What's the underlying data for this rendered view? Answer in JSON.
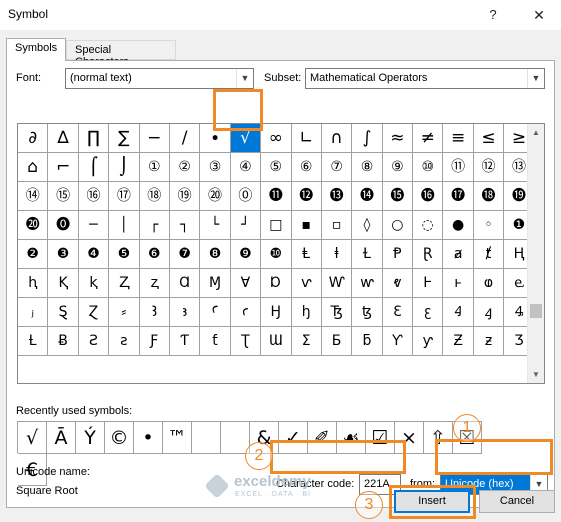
{
  "window": {
    "title": "Symbol",
    "help_glyph": "?",
    "close_glyph": "✕"
  },
  "tabs": [
    {
      "label": "Symbols",
      "active": true
    },
    {
      "label": "Special Characters",
      "active": false
    }
  ],
  "font": {
    "label": "Font:",
    "value": "(normal text)"
  },
  "subset": {
    "label": "Subset:",
    "value": "Mathematical Operators"
  },
  "symbol_grid": {
    "selected_index": 7,
    "rows": [
      [
        "∂",
        "∆",
        "∏",
        "∑",
        "−",
        "∕",
        "∙",
        "√",
        "∞",
        "∟",
        "∩",
        "∫",
        "≈",
        "≠",
        "≡",
        "≤",
        "≥"
      ],
      [
        "⌂",
        "⌐",
        "⌠",
        "⌡",
        "①",
        "②",
        "③",
        "④",
        "⑤",
        "⑥",
        "⑦",
        "⑧",
        "⑨",
        "⑩",
        "⑪",
        "⑫",
        "⑬"
      ],
      [
        "⑭",
        "⑮",
        "⑯",
        "⑰",
        "⑱",
        "⑲",
        "⑳",
        "⓪",
        "⓫",
        "⓬",
        "⓭",
        "⓮",
        "⓯",
        "⓰",
        "⓱",
        "⓲",
        "⓳"
      ],
      [
        "⓴",
        "⓿",
        "─",
        "│",
        "┌",
        "┐",
        "└",
        "┘",
        "□",
        "▪",
        "▫",
        "◊",
        "○",
        "◌",
        "●",
        "◦",
        "❶"
      ],
      [
        "❷",
        "❸",
        "❹",
        "❺",
        "❻",
        "❼",
        "❽",
        "❾",
        "❿",
        "Ⱡ",
        "ⱡ",
        "Ɫ",
        "Ᵽ",
        "Ɽ",
        "ⱥ",
        "ⱦ",
        "Ⱨ"
      ],
      [
        "ⱨ",
        "Ⱪ",
        "ⱪ",
        "Ⱬ",
        "ⱬ",
        "Ɑ",
        "Ɱ",
        "Ɐ",
        "Ɒ",
        "ⱱ",
        "Ⱳ",
        "ⱳ",
        "ⱴ",
        "Ⱶ",
        "ⱶ",
        "ⱷ",
        "ⱸ"
      ],
      [
        "ⱼ",
        "Ȿ",
        "Ɀ",
        "⸗",
        "Ꜣ",
        "ꜣ",
        "Ꜥ",
        "ꜥ",
        "Ꜧ",
        "ꜧ",
        "Ꜩ",
        "ꜩ",
        "Ꜫ",
        "ꜫ",
        "Ꜭ",
        "ꜭ",
        "Ꜯ"
      ],
      [
        "Ƚ",
        "Ƀ",
        "Ƨ",
        "ƨ",
        "Ƒ",
        "Ƭ",
        "ƭ",
        "Ʈ",
        "Ɯ",
        "Ʃ",
        "Ƃ",
        "ƃ",
        "Ƴ",
        "ƴ",
        "Ƶ",
        "ƶ",
        "Ʒ"
      ]
    ]
  },
  "recent": {
    "label": "Recently used symbols:",
    "symbols": [
      "√",
      "Ā",
      "Ý",
      "©",
      "•",
      "™",
      "",
      "",
      "&",
      "✓",
      "✐",
      "☙",
      "☑",
      "×",
      "⇧",
      "☒",
      "€"
    ]
  },
  "unicode_name": {
    "label": "Unicode name:",
    "value": "Square Root"
  },
  "char_code": {
    "label": "Character code:",
    "value": "221A"
  },
  "from": {
    "label": "from:",
    "value": "Unicode (hex)"
  },
  "buttons": {
    "insert": "Insert",
    "cancel": "Cancel"
  },
  "annotations": {
    "step1": "1",
    "step2": "2",
    "step3": "3",
    "color": "#f08a24"
  },
  "watermark": {
    "name": "exceldemy",
    "tagline": "EXCEL · DATA · BI"
  },
  "colors": {
    "selection": "#0078d7",
    "dialog_bg": "#f0f0f0"
  }
}
